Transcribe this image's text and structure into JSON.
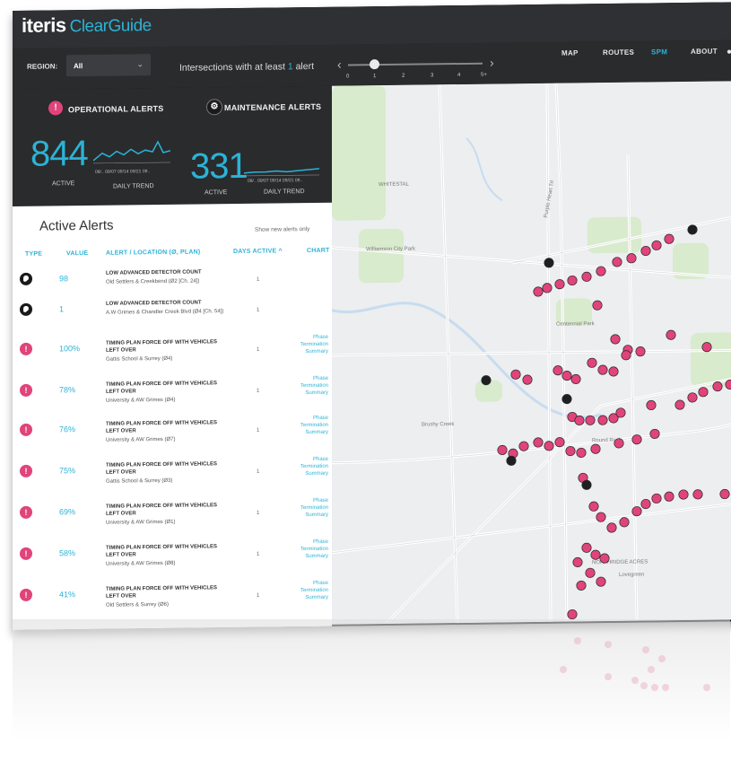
{
  "app": {
    "brand": "iteris",
    "product": "ClearGuide"
  },
  "nav": {
    "items": [
      "MAP",
      "ROUTES",
      "SPM",
      "ABOUT"
    ],
    "active": "SPM"
  },
  "filter": {
    "region_label": "REGION:",
    "region_value": "All",
    "intersections_prefix": "Intersections with at least",
    "intersections_count": "1",
    "intersections_suffix": "alert",
    "slider_ticks": [
      "0",
      "1",
      "2",
      "3",
      "4",
      "5+"
    ],
    "slider_value": 1
  },
  "operational": {
    "title": "OPERATIONAL ALERTS",
    "count": "844",
    "active_label": "ACTIVE",
    "trend_label": "DAILY TREND",
    "dates": "08/.. 09/07  09/14  09/21  09.."
  },
  "maintenance": {
    "title": "MAINTENANCE ALERTS",
    "count": "331",
    "active_label": "ACTIVE",
    "trend_label": "DAILY TREND",
    "dates": "08/.. 09/07  09/14  09/21  09.."
  },
  "alerts": {
    "title": "Active Alerts",
    "show_new": "Show new alerts only",
    "columns": [
      "TYPE",
      "VALUE",
      "ALERT / LOCATION (Ø, PLAN)",
      "DAYS ACTIVE ^",
      "CHART"
    ],
    "rows": [
      {
        "type": "maintenance",
        "value": "98",
        "name": "LOW ADVANCED DETECTOR COUNT",
        "location": "Old Settlers & Creekbend (Ø2 [Ch. 24])",
        "days": "1",
        "chart": ""
      },
      {
        "type": "maintenance",
        "value": "1",
        "name": "LOW ADVANCED DETECTOR COUNT",
        "location": "A.W Grimes & Chandler Creek Blvd (Ø4 [Ch. 54])",
        "days": "1",
        "chart": ""
      },
      {
        "type": "operational",
        "value": "100%",
        "name": "TIMING PLAN FORCE OFF WITH VEHICLES LEFT OVER",
        "location": "Gattis School & Surrey (Ø4)",
        "days": "1",
        "chart": "Phase Termination Summary"
      },
      {
        "type": "operational",
        "value": "78%",
        "name": "TIMING PLAN FORCE OFF WITH VEHICLES LEFT OVER",
        "location": "University & AW Grimes (Ø4)",
        "days": "1",
        "chart": "Phase Termination Summary"
      },
      {
        "type": "operational",
        "value": "76%",
        "name": "TIMING PLAN FORCE OFF WITH VEHICLES LEFT OVER",
        "location": "University & AW Grimes (Ø7)",
        "days": "1",
        "chart": "Phase Termination Summary"
      },
      {
        "type": "operational",
        "value": "75%",
        "name": "TIMING PLAN FORCE OFF WITH VEHICLES LEFT OVER",
        "location": "Gattis School & Surrey (Ø3)",
        "days": "1",
        "chart": "Phase Termination Summary"
      },
      {
        "type": "operational",
        "value": "69%",
        "name": "TIMING PLAN FORCE OFF WITH VEHICLES LEFT OVER",
        "location": "University & AW Grimes (Ø1)",
        "days": "1",
        "chart": "Phase Termination Summary"
      },
      {
        "type": "operational",
        "value": "58%",
        "name": "TIMING PLAN FORCE OFF WITH VEHICLES LEFT OVER",
        "location": "University & AW Grimes (Ø8)",
        "days": "1",
        "chart": "Phase Termination Summary"
      },
      {
        "type": "operational",
        "value": "41%",
        "name": "TIMING PLAN FORCE OFF WITH VEHICLES LEFT OVER",
        "location": "Old Settlers & Surrey (Ø6)",
        "days": "1",
        "chart": "Phase Termination Summary"
      }
    ]
  },
  "map": {
    "labels": [
      "Purple Heart Trl",
      "WHITESTAL",
      "Williamson City Park",
      "Round Rock",
      "Brushy Creek",
      "NORTHRIDGE ACRES",
      "Lovegreen",
      "Centennial Park"
    ],
    "marker_color": "#e0447a",
    "marker_dark": "#1f1f1f"
  },
  "colors": {
    "accent": "#2bb3d6",
    "alert": "#e0447a",
    "panel": "#2a2b2d"
  }
}
